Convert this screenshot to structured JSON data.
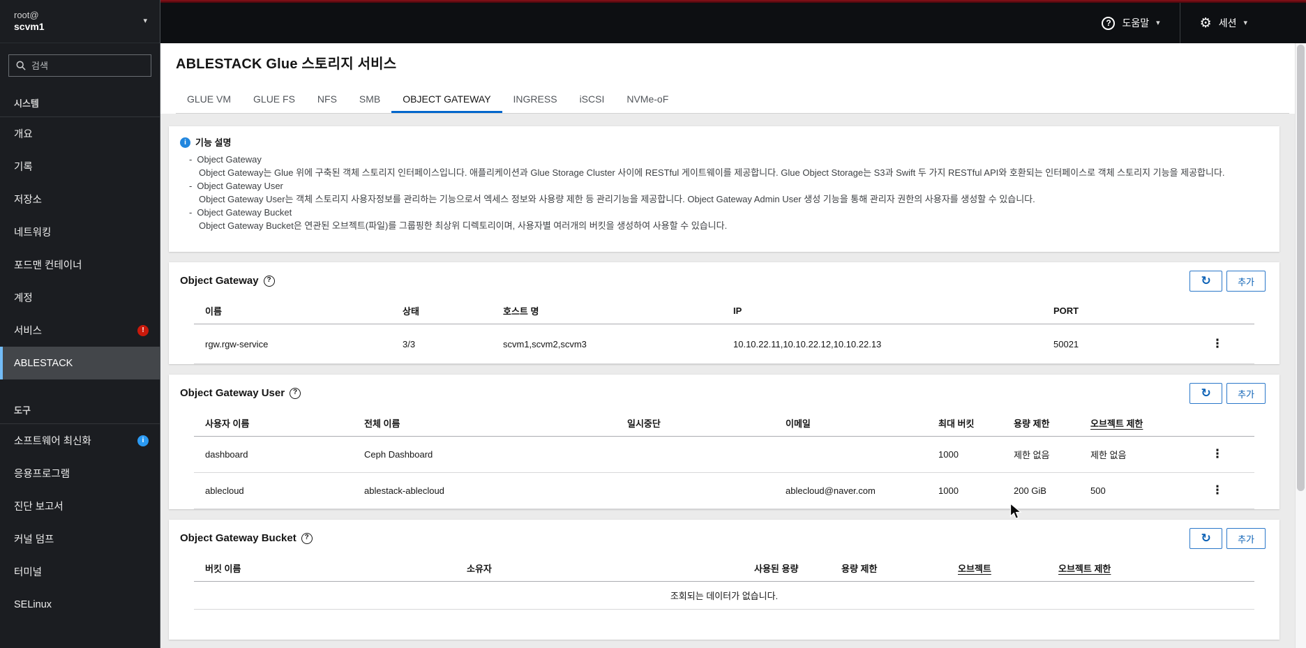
{
  "masthead": {
    "user_prefix": "root@",
    "hostname": "scvm1",
    "help_label": "도움말",
    "session_label": "세션"
  },
  "sidebar": {
    "search_placeholder": "검색",
    "system_section_label": "시스템",
    "tools_section_label": "도구",
    "system_items": [
      {
        "label": "개요"
      },
      {
        "label": "기록"
      },
      {
        "label": "저장소"
      },
      {
        "label": "네트워킹"
      },
      {
        "label": "포드맨 컨테이너"
      },
      {
        "label": "계정"
      },
      {
        "label": "서비스",
        "badge": "!"
      },
      {
        "label": "ABLESTACK",
        "selected": true
      }
    ],
    "tools_items": [
      {
        "label": "소프트웨어 최신화",
        "badge": "i"
      },
      {
        "label": "응용프로그램"
      },
      {
        "label": "진단 보고서"
      },
      {
        "label": "커널 덤프"
      },
      {
        "label": "터미널"
      },
      {
        "label": "SELinux"
      }
    ]
  },
  "page": {
    "title": "ABLESTACK Glue 스토리지 서비스",
    "tabs": [
      {
        "label": "GLUE VM"
      },
      {
        "label": "GLUE FS"
      },
      {
        "label": "NFS"
      },
      {
        "label": "SMB"
      },
      {
        "label": "OBJECT GATEWAY",
        "active": true
      },
      {
        "label": "INGRESS"
      },
      {
        "label": "iSCSI"
      },
      {
        "label": "NVMe-oF"
      }
    ]
  },
  "info": {
    "heading": "기능 설명",
    "entries": [
      {
        "term": "Object Gateway",
        "desc": "Object Gateway는 Glue 위에 구축된 객체 스토리지 인터페이스입니다. 애플리케이션과 Glue Storage Cluster 사이에 RESTful 게이트웨이를 제공합니다. Glue Object Storage는 S3과 Swift 두 가지 RESTful API와 호환되는 인터페이스로 객체 스토리지 기능을 제공합니다."
      },
      {
        "term": "Object Gateway User",
        "desc": "Object Gateway User는 객체 스토리지 사용자정보를 관리하는 기능으로서 엑세스 정보와 사용량 제한 등 관리기능을 제공합니다. Object Gateway Admin User 생성 기능을 통해 관리자 권한의 사용자를 생성할 수 있습니다."
      },
      {
        "term": "Object Gateway Bucket",
        "desc": "Object Gateway Bucket은 연관된 오브젝트(파일)를 그룹핑한 최상위 디렉토리이며, 사용자별 여러개의 버킷을 생성하여 사용할 수 있습니다."
      }
    ]
  },
  "gateway": {
    "title": "Object Gateway",
    "add_label": "추가",
    "columns": [
      "이름",
      "상태",
      "호스트 명",
      "IP",
      "PORT"
    ],
    "rows": [
      {
        "name": "rgw.rgw-service",
        "status": "3/3",
        "hosts": "scvm1,scvm2,scvm3",
        "ip": "10.10.22.11,10.10.22.12,10.10.22.13",
        "port": "50021"
      }
    ]
  },
  "users": {
    "title": "Object Gateway User",
    "add_label": "추가",
    "columns": [
      "사용자 이름",
      "전체 이름",
      "일시중단",
      "이메일",
      "최대 버킷",
      "용량 제한",
      "오브젝트 제한"
    ],
    "rows": [
      {
        "username": "dashboard",
        "fullname": "Ceph Dashboard",
        "suspended": "",
        "email": "",
        "max_buckets": "1000",
        "quota": "제한 없음",
        "object_limit": "제한 없음"
      },
      {
        "username": "ablecloud",
        "fullname": "ablestack-ablecloud",
        "suspended": "",
        "email": "ablecloud@naver.com",
        "max_buckets": "1000",
        "quota": "200 GiB",
        "object_limit": "500"
      }
    ]
  },
  "buckets": {
    "title": "Object Gateway Bucket",
    "add_label": "추가",
    "columns": [
      "버킷 이름",
      "소유자",
      "사용된 용량",
      "용량 제한",
      "오브젝트",
      "오브젝트 제한"
    ],
    "empty_message": "조회되는 데이터가 없습니다."
  },
  "icons": {
    "question_mark": "?",
    "info_i": "i",
    "gear": "⚙",
    "caret": "▾",
    "kebab": "⋮",
    "refresh": "↻"
  },
  "colors": {
    "accent_blue": "#0066cc",
    "masthead_red": "#7d1007",
    "sidebar_bg": "#1b1d21",
    "selected_nav_border": "#73bcf7",
    "badge_red": "#c9190b",
    "badge_blue": "#2b9af3"
  }
}
